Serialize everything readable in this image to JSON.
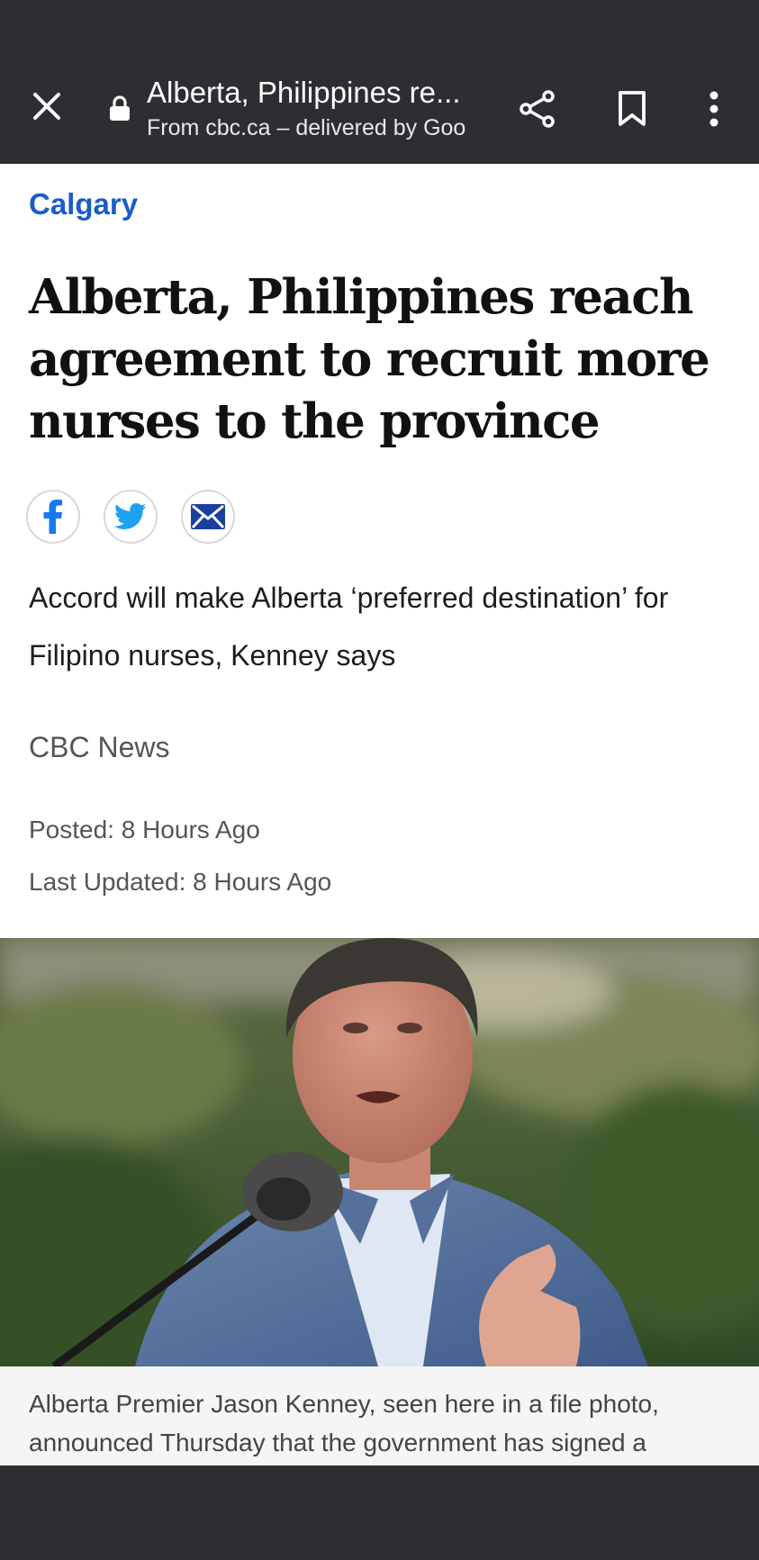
{
  "browser": {
    "page_title": "Alberta, Philippines re...",
    "origin": "From cbc.ca – delivered by Goo",
    "icons": [
      "close-icon",
      "lock-icon",
      "share-icon",
      "bookmark-icon",
      "more-vert-icon"
    ]
  },
  "article": {
    "section": "Calgary",
    "headline": "Alberta, Philippines reach agreement to recruit more nurses to the province",
    "social_icons": [
      "facebook-icon",
      "twitter-icon",
      "email-icon"
    ],
    "dek": "Accord will make Alberta ‘preferred destination’ for Filipino nurses, Kenney says",
    "source": "CBC News",
    "posted": "Posted: 8 Hours Ago",
    "last_updated": "Last Updated: 8 Hours Ago",
    "photo_caption": "Alberta Premier Jason Kenney, seen here in a file photo, announced Thursday that the government has signed a"
  },
  "colors": {
    "toolbar": "#2d2e32",
    "section_link": "#1a5cc8",
    "twitter": "#1da1f2",
    "facebook": "#1877f2",
    "email": "#1a3fa0"
  }
}
